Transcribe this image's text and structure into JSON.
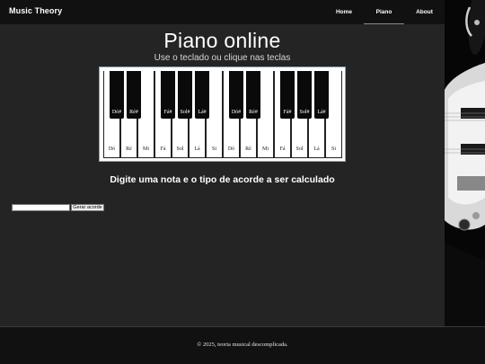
{
  "nav": {
    "brand": "Music Theory",
    "items": [
      {
        "label": "Home"
      },
      {
        "label": "Piano",
        "active": true
      },
      {
        "label": "About"
      }
    ]
  },
  "main": {
    "title": "Piano online",
    "subtitle": "Use o teclado ou clique nas teclas",
    "prompt": "Digite uma nota e o tipo de acorde a ser calculado",
    "input_value": "",
    "button_label": "Gerar acorde"
  },
  "piano": {
    "white_keys": [
      "Dó",
      "Ré",
      "Mi",
      "Fá",
      "Sol",
      "Lá",
      "Si",
      "Dó",
      "Ré",
      "Mi",
      "Fá",
      "Sol",
      "Lá",
      "Si"
    ],
    "black_keys": [
      "Dó#",
      "Ré#",
      "Fá#",
      "Sol#",
      "Lá#",
      "Dó#",
      "Ré#",
      "Fá#",
      "Sol#",
      "Lá#"
    ]
  },
  "footer": {
    "text": "© 2025, teoria musical descomplicada."
  },
  "colors": {
    "page_background": "#242424",
    "nav_background": "#111111",
    "footer_background": "#111111",
    "active_underline": "#8a8a8a"
  }
}
